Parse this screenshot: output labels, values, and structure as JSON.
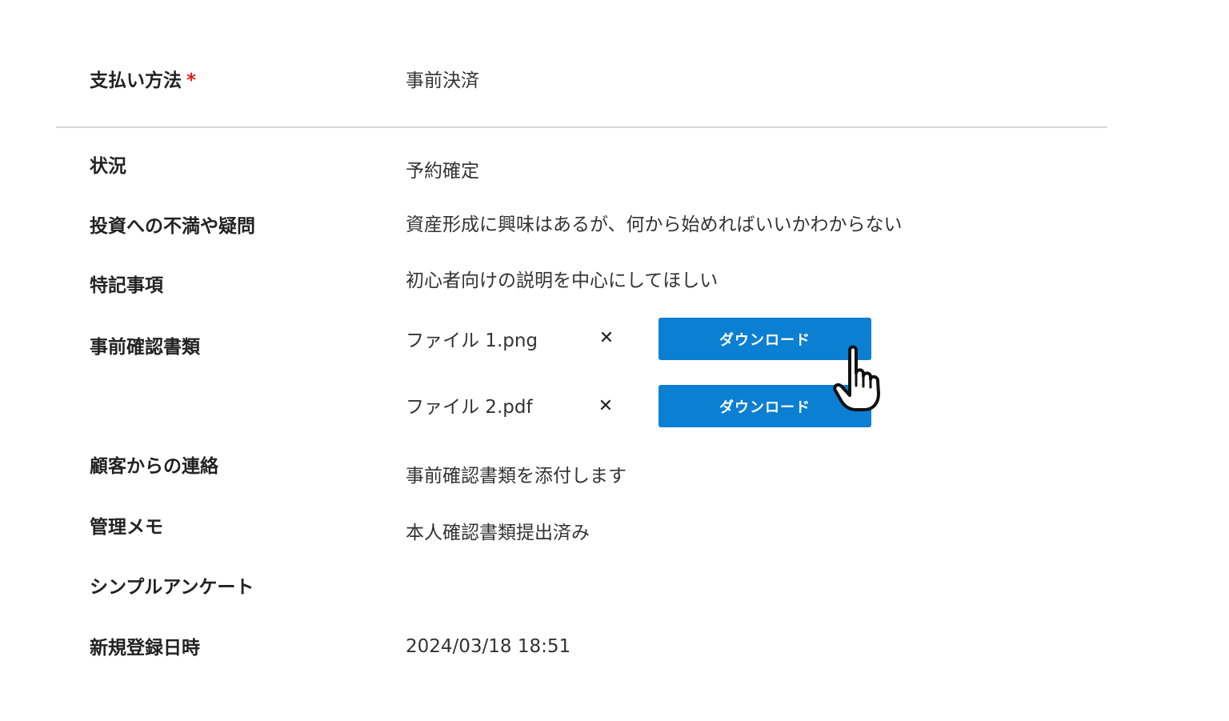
{
  "payment": {
    "label": "支払い方法",
    "required_mark": "*",
    "value": "事前決済"
  },
  "rows": {
    "status": {
      "label": "状況",
      "value": "予約確定"
    },
    "concern": {
      "label": "投資への不満や疑問",
      "value": "資産形成に興味はあるが、何から始めればいいかわからない"
    },
    "notes": {
      "label": "特記事項",
      "value": "初心者向けの説明を中心にしてほしい"
    },
    "documents": {
      "label": "事前確認書類"
    },
    "contact": {
      "label": "顧客からの連絡",
      "value": "事前確認書類を添付します"
    },
    "memo": {
      "label": "管理メモ",
      "value": "本人確認書類提出済み"
    },
    "survey": {
      "label": "シンプルアンケート",
      "value": ""
    },
    "registered": {
      "label": "新規登録日時",
      "value": "2024/03/18 18:51"
    }
  },
  "files": [
    {
      "name": "ファイル 1.png",
      "remove": "✕",
      "download_label": "ダウンロード"
    },
    {
      "name": "ファイル 2.pdf",
      "remove": "✕",
      "download_label": "ダウンロード"
    }
  ],
  "colors": {
    "accent": "#0b7fd2",
    "required": "#e0201c",
    "divider": "#d9d9d9"
  },
  "icons": {
    "cursor": "hand-pointer-icon",
    "remove": "close-icon"
  }
}
